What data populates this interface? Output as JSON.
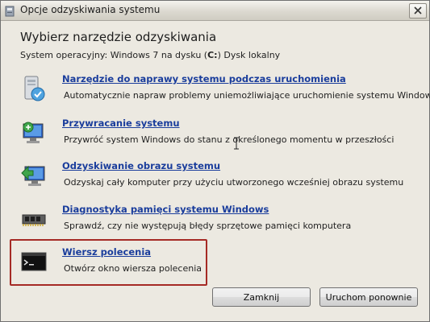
{
  "window": {
    "title": "Opcje odzyskiwania systemu",
    "close_label": "×"
  },
  "heading": "Wybierz narzędzie odzyskiwania",
  "os_info": {
    "prefix": "System operacyjny: Windows 7 na dysku (",
    "drive": "C:",
    "suffix": ") Dysk lokalny"
  },
  "tools": [
    {
      "icon": "startup-repair-icon",
      "title": "Narzędzie do naprawy systemu podczas uruchomienia",
      "description": "Automatycznie napraw problemy uniemożliwiające uruchomienie systemu Windows"
    },
    {
      "icon": "system-restore-icon",
      "title": "Przywracanie systemu",
      "description": "Przywróć system Windows do stanu z określonego momentu w przeszłości"
    },
    {
      "icon": "image-recovery-icon",
      "title": "Odzyskiwanie obrazu systemu",
      "description": "Odzyskaj cały komputer przy użyciu utworzonego wcześniej obrazu systemu"
    },
    {
      "icon": "memory-diagnostic-icon",
      "title": "Diagnostyka pamięci systemu Windows",
      "description": "Sprawdź, czy nie występują błędy sprzętowe pamięci komputera"
    },
    {
      "icon": "command-prompt-icon",
      "title": "Wiersz polecenia",
      "description": "Otwórz okno wiersza polecenia",
      "highlighted": true
    }
  ],
  "buttons": {
    "close": "Zamknij",
    "restart": "Uruchom ponownie"
  },
  "colors": {
    "link": "#1a3d9c",
    "highlight_border": "#a52a25",
    "dialog_bg": "#ece9e1"
  }
}
